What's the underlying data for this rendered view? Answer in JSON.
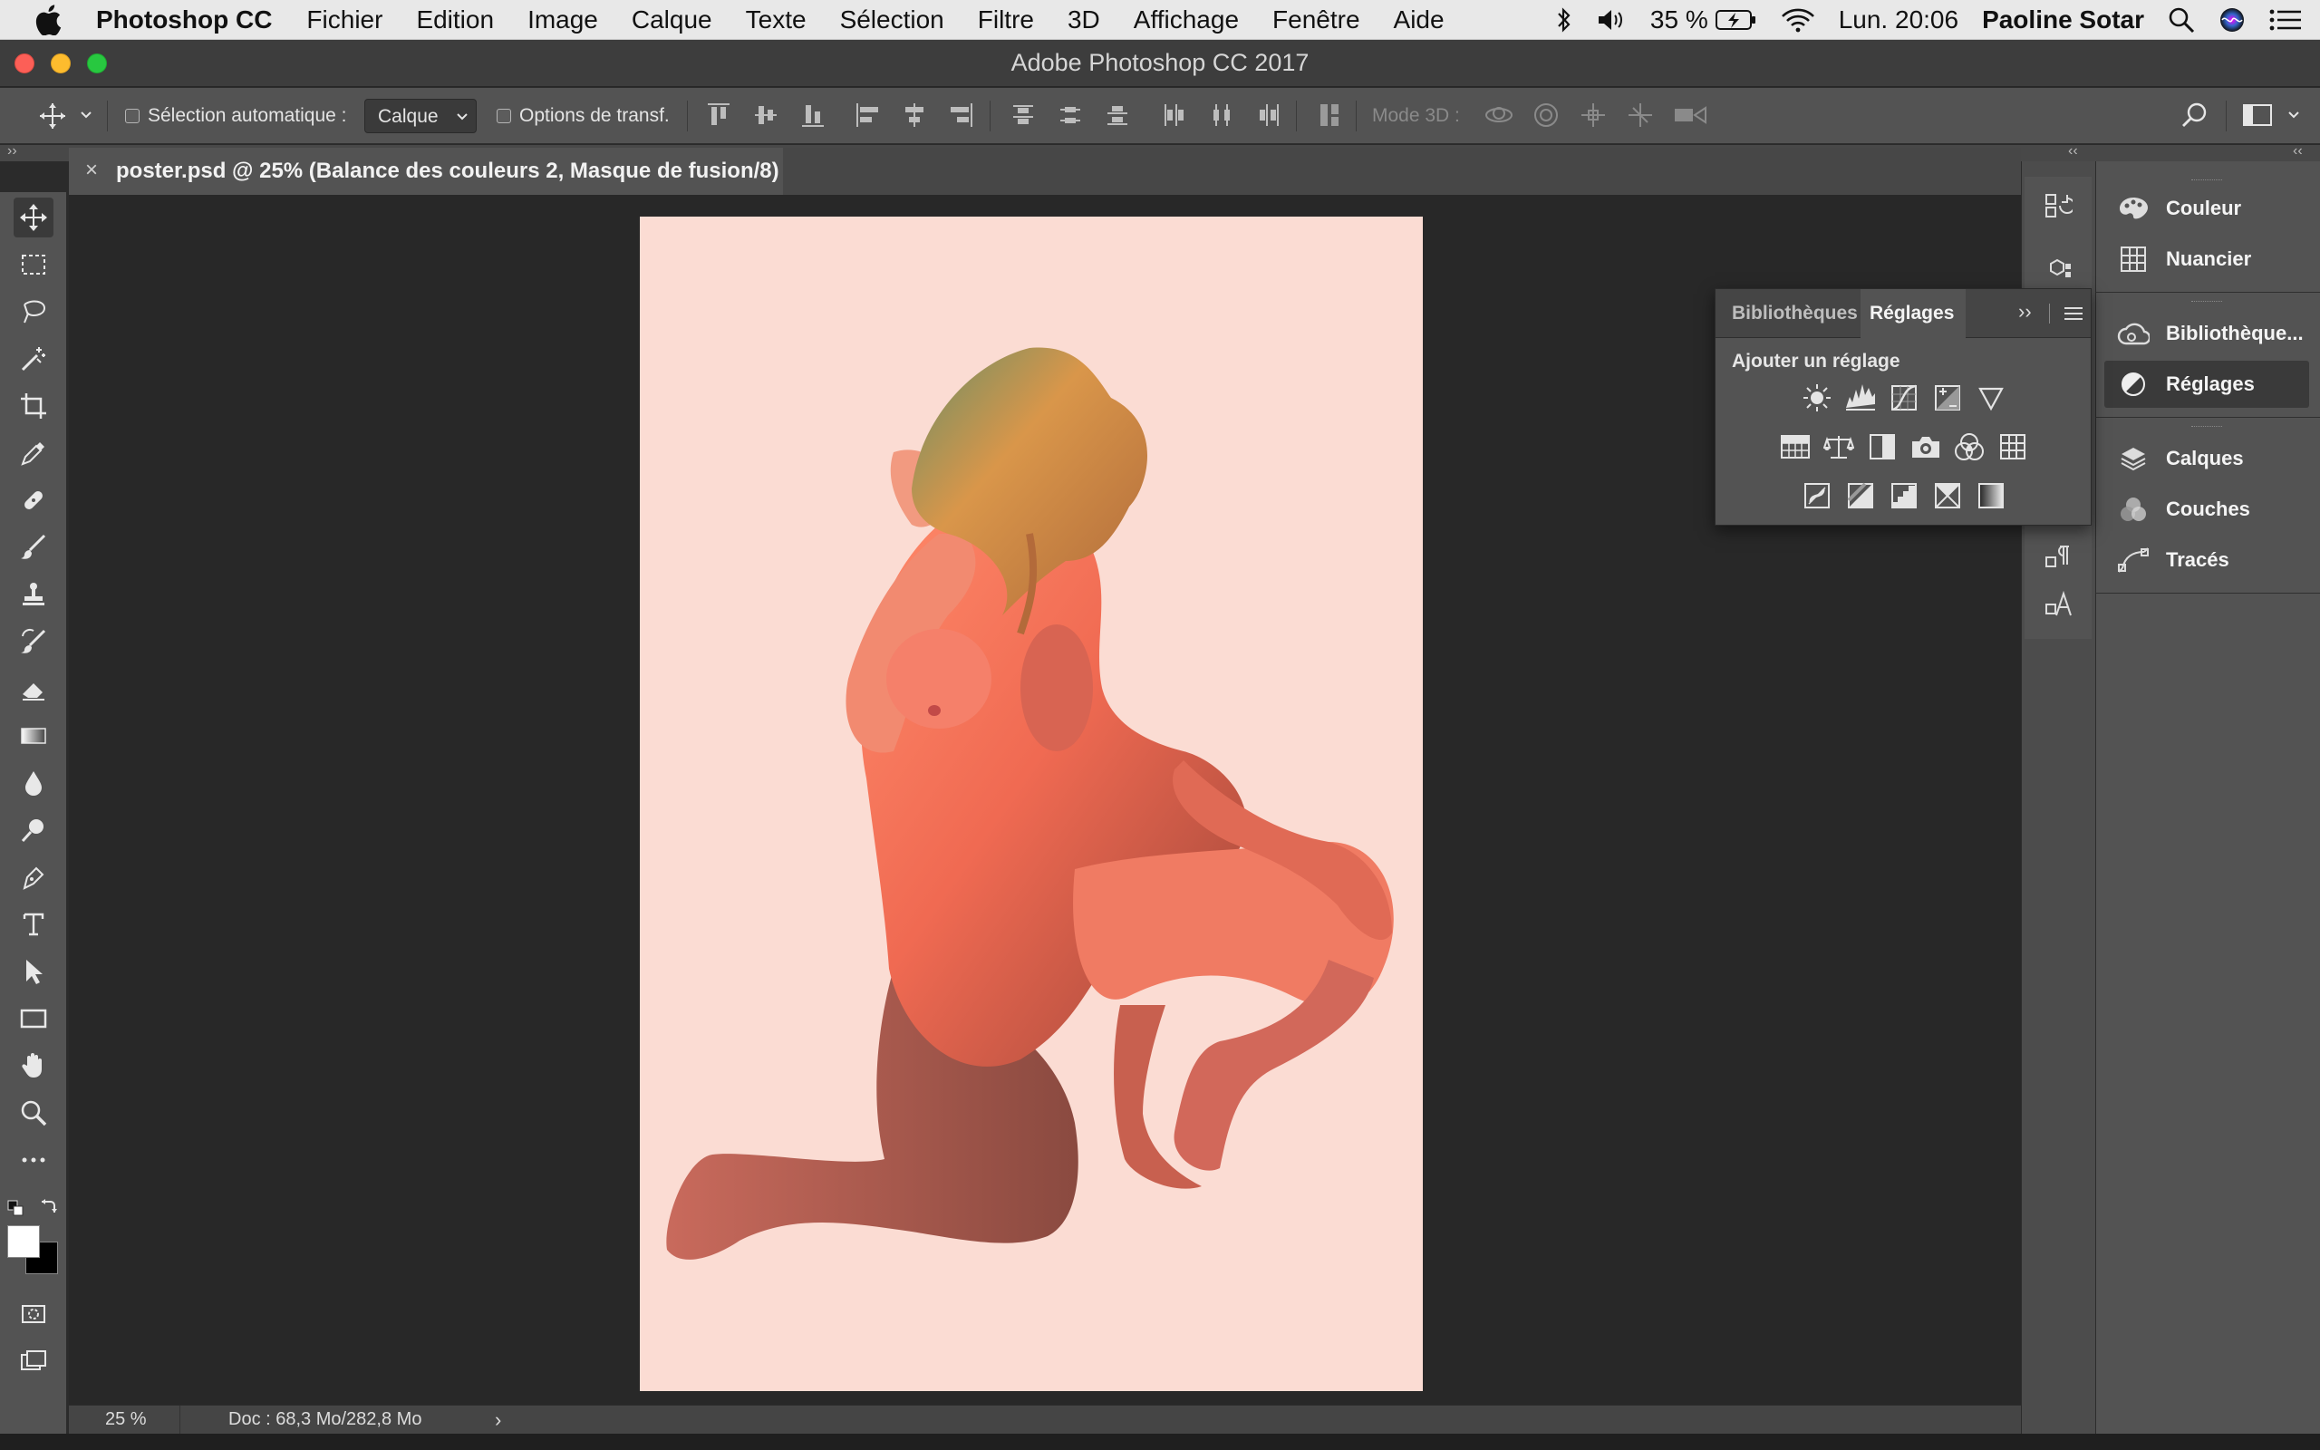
{
  "menubar": {
    "app_name": "Photoshop CC",
    "items": [
      "Fichier",
      "Edition",
      "Image",
      "Calque",
      "Texte",
      "Sélection",
      "Filtre",
      "3D",
      "Affichage",
      "Fenêtre",
      "Aide"
    ],
    "battery": "35 %",
    "clock": "Lun. 20:06",
    "user": "Paoline Sotar"
  },
  "window": {
    "title": "Adobe Photoshop CC 2017"
  },
  "options_bar": {
    "auto_select_label": "Sélection automatique :",
    "auto_select_checked": false,
    "auto_select_target": "Calque",
    "transform_label": "Options de transf.",
    "transform_checked": false,
    "mode_3d_label": "Mode 3D :"
  },
  "document": {
    "tab_title": "poster.psd @ 25% (Balance des couleurs 2, Masque de fusion/8)",
    "close_glyph": "×",
    "canvas_color": "#fbdcd3"
  },
  "status_bar": {
    "zoom": "25 %",
    "doc_info": "Doc : 68,3 Mo/282,8 Mo",
    "arrow": "›"
  },
  "adjustments_panel": {
    "tabs": [
      "Bibliothèques",
      "Réglages"
    ],
    "active_tab": "Réglages",
    "heading": "Ajouter un réglage"
  },
  "right_panels": {
    "group1": [
      "Couleur",
      "Nuancier"
    ],
    "group2": [
      "Bibliothèque...",
      "Réglages"
    ],
    "group3": [
      "Calques",
      "Couches",
      "Tracés"
    ],
    "selected": "Réglages"
  },
  "colors": {
    "accent_active": "#3a3a3a",
    "foreground": "#ffffff",
    "background": "#000000"
  }
}
